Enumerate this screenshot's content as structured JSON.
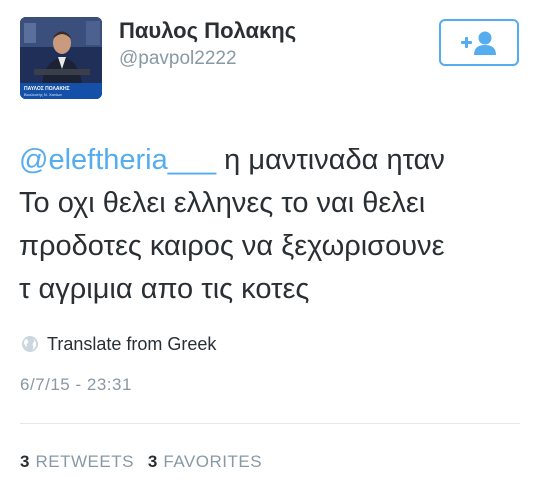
{
  "tweet": {
    "author": {
      "display_name": "Παυλος Πολακης",
      "handle": "@pavpol2222",
      "avatar": {
        "caption_line1": "ΠΑΥΛΟΣ ΠΟΛΑΚΗΣ",
        "caption_line2": "Βουλευτής Ν. Χανίων"
      }
    },
    "follow_button": {
      "icon": "add-user-icon"
    },
    "text": {
      "mention": "@eleftheria___",
      "line1_rest": " η μαντιναδα ηταν",
      "line2": "Το οχι θελει ελληνες το ναι θελει",
      "line3": "προδοτες καιρος να ξεχωρισουνε",
      "line4": "τ αγριμια απο τις κοτες"
    },
    "translate": {
      "icon": "globe-icon",
      "label": "Translate from Greek"
    },
    "timestamp": "6/7/15 - 23:31",
    "stats": {
      "retweets_count": "3",
      "retweets_label": "RETWEETS",
      "favorites_count": "3",
      "favorites_label": "FAVORITES"
    }
  },
  "colors": {
    "accent": "#55acee",
    "text": "#292f33",
    "muted": "#8899a6",
    "divider": "#e1e8ed"
  }
}
